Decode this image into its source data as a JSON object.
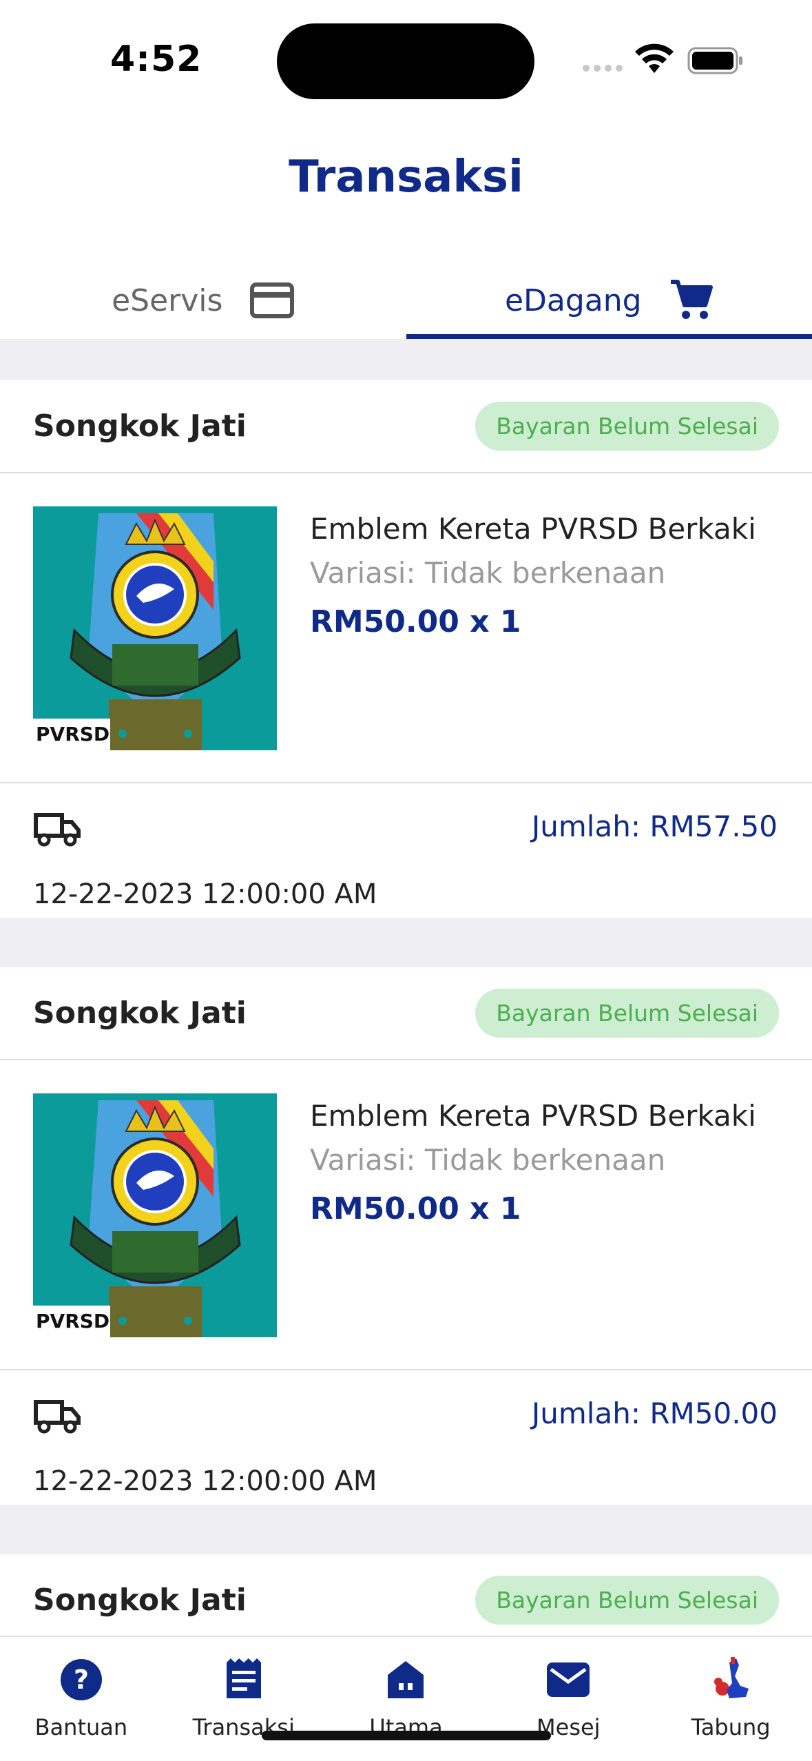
{
  "status_bar": {
    "time": "4:52"
  },
  "header": {
    "title": "Transaksi"
  },
  "tabs": [
    {
      "label": "eServis",
      "icon": "credit-card-icon",
      "active": false
    },
    {
      "label": "eDagang",
      "icon": "shopping-cart-icon",
      "active": true
    }
  ],
  "orders": [
    {
      "shop": "Songkok Jati",
      "status": "Bayaran Belum Selesai",
      "item_name": "Emblem Kereta PVRSD Berkaki",
      "variant": "Variasi: Tidak berkenaan",
      "price": "RM50.00 x 1",
      "image_label": "PVRSD",
      "total": "Jumlah: RM57.50",
      "date": "12-22-2023 12:00:00 AM"
    },
    {
      "shop": "Songkok Jati",
      "status": "Bayaran Belum Selesai",
      "item_name": "Emblem Kereta PVRSD Berkaki",
      "variant": "Variasi: Tidak berkenaan",
      "price": "RM50.00 x 1",
      "image_label": "PVRSD",
      "total": "Jumlah: RM50.00",
      "date": "12-22-2023 12:00:00 AM"
    },
    {
      "shop": "Songkok Jati",
      "status": "Bayaran Belum Selesai"
    }
  ],
  "bottom_nav": [
    {
      "label": "Bantuan",
      "icon": "help-icon"
    },
    {
      "label": "Transaksi",
      "icon": "receipt-icon"
    },
    {
      "label": "Utama",
      "icon": "home-icon"
    },
    {
      "label": "Mesej",
      "icon": "mail-icon"
    },
    {
      "label": "Tabung",
      "icon": "tabung-logo-icon"
    }
  ],
  "colors": {
    "primary": "#102a8a",
    "badge_bg": "#cdeed0",
    "badge_text": "#4caf50",
    "list_bg": "#efeff3"
  }
}
